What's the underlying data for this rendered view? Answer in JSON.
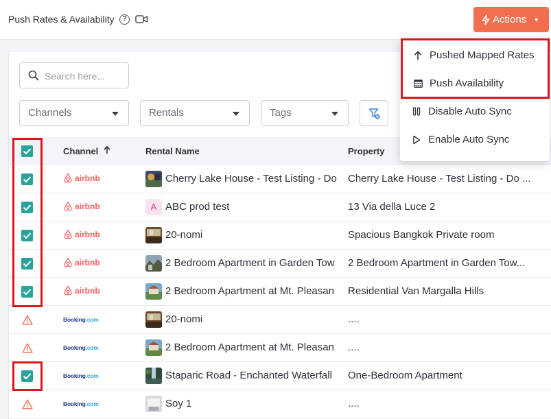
{
  "header": {
    "title": "Push Rates & Availability",
    "actions_label": "Actions"
  },
  "search": {
    "placeholder": "Search here..."
  },
  "filters": {
    "channels_label": "Channels",
    "rentals_label": "Rentals",
    "tags_label": "Tags"
  },
  "table": {
    "columns": {
      "channel": "Channel",
      "rental_name": "Rental Name",
      "property": "Property"
    },
    "channel_labels": {
      "airbnb": "airbnb",
      "booking_main": "Booking",
      "booking_suffix": ".com"
    },
    "rows": [
      {
        "channel": "airbnb",
        "checked": true,
        "thumb": "photo-lake",
        "rental": "Cherry Lake House - Test Listing - Do",
        "property": "Cherry Lake House - Test Listing - Do ..."
      },
      {
        "channel": "airbnb",
        "checked": true,
        "thumb": "letter",
        "thumb_letter": "A",
        "rental": "ABC prod test",
        "property": "13 Via della Luce 2"
      },
      {
        "channel": "airbnb",
        "checked": true,
        "thumb": "photo-room",
        "rental": "20-nomi",
        "property": "Spacious Bangkok Private room"
      },
      {
        "channel": "airbnb",
        "checked": true,
        "thumb": "photo-garden",
        "rental": "2 Bedroom Apartment in Garden Tow",
        "property": "2 Bedroom Apartment in Garden Tow..."
      },
      {
        "channel": "airbnb",
        "checked": true,
        "thumb": "photo-villa",
        "rental": "2 Bedroom Apartment at Mt. Pleasan",
        "property": "Residential Van Margalla Hills"
      },
      {
        "channel": "booking",
        "checked": false,
        "thumb": "photo-room",
        "rental": "20-nomi",
        "property": "...."
      },
      {
        "channel": "booking",
        "checked": false,
        "thumb": "photo-villa",
        "rental": "2 Bedroom Apartment at Mt. Pleasan",
        "property": "...."
      },
      {
        "channel": "booking",
        "checked": true,
        "thumb": "photo-falls",
        "rental": "Staparic Road - Enchanted Waterfall",
        "property": "One-Bedroom Apartment"
      },
      {
        "channel": "booking",
        "checked": false,
        "thumb": "photo-soy",
        "rental": "Soy 1",
        "property": "...."
      }
    ]
  },
  "actions_menu": {
    "items": [
      {
        "label": "Pushed Mapped Rates",
        "icon": "arrow-up-icon"
      },
      {
        "label": "Push Availability",
        "icon": "calendar-icon"
      },
      {
        "label": "Disable Auto Sync",
        "icon": "pause-icon"
      },
      {
        "label": "Enable Auto Sync",
        "icon": "play-icon"
      }
    ]
  },
  "colors": {
    "accent": "#f36e4f",
    "checkbox": "#2aa39a",
    "airbnb": "#ff5a5f",
    "booking": "#1e3b86",
    "warning": "#f36e4f",
    "highlight": "#e0141a"
  }
}
